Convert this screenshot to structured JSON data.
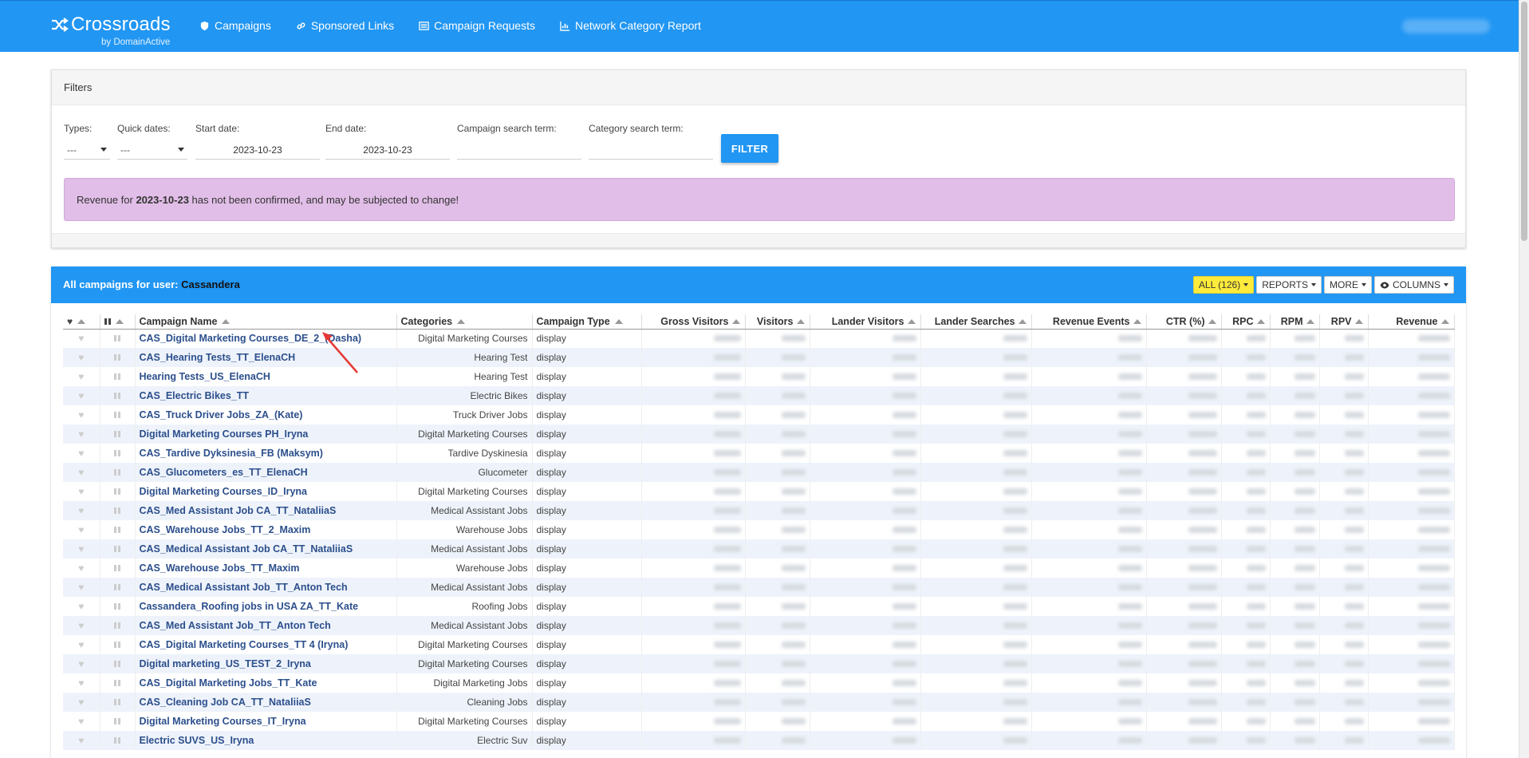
{
  "brand": {
    "name": "Crossroads",
    "sub": "by DomainActive"
  },
  "nav": [
    {
      "label": "Campaigns",
      "icon": "shield-icon"
    },
    {
      "label": "Sponsored Links",
      "icon": "link-icon"
    },
    {
      "label": "Campaign Requests",
      "icon": "list-icon"
    },
    {
      "label": "Network Category Report",
      "icon": "chart-icon"
    }
  ],
  "filters": {
    "title": "Filters",
    "types_label": "Types:",
    "types_value": "---",
    "quick_label": "Quick dates:",
    "quick_value": "---",
    "start_label": "Start date:",
    "start_value": "2023-10-23",
    "end_label": "End date:",
    "end_value": "2023-10-23",
    "campaign_search_label": "Campaign search term:",
    "category_search_label": "Category search term:",
    "filter_button": "FILTER",
    "alert_pre": "Revenue for ",
    "alert_date": "2023-10-23",
    "alert_post": " has not been confirmed, and may be subjected to change!"
  },
  "campaigns": {
    "title_pre": "All campaigns for user: ",
    "user": "Cassandera",
    "buttons": {
      "all": "ALL (126)",
      "reports": "REPORTS",
      "more": "MORE",
      "columns": "COLUMNS"
    },
    "columns": [
      "Campaign Name",
      "Categories",
      "Campaign Type",
      "Gross Visitors",
      "Visitors",
      "Lander Visitors",
      "Lander Searches",
      "Revenue Events",
      "CTR (%)",
      "RPC",
      "RPM",
      "RPV",
      "Revenue"
    ],
    "rows": [
      {
        "name": "CAS_Digital Marketing Courses_DE_2_(Dasha)",
        "category": "Digital Marketing Courses",
        "type": "display"
      },
      {
        "name": "CAS_Hearing Tests_TT_ElenaCH",
        "category": "Hearing Test",
        "type": "display"
      },
      {
        "name": "Hearing Tests_US_ElenaCH",
        "category": "Hearing Test",
        "type": "display"
      },
      {
        "name": "CAS_Electric Bikes_TT",
        "category": "Electric Bikes",
        "type": "display"
      },
      {
        "name": "CAS_Truck Driver Jobs_ZA_(Kate)",
        "category": "Truck Driver Jobs",
        "type": "display"
      },
      {
        "name": "Digital Marketing Courses PH_Iryna",
        "category": "Digital Marketing Courses",
        "type": "display"
      },
      {
        "name": "CAS_Tardive Dyksinesia_FB (Maksym)",
        "category": "Tardive Dyskinesia",
        "type": "display"
      },
      {
        "name": "CAS_Glucometers_es_TT_ElenaCH",
        "category": "Glucometer",
        "type": "display"
      },
      {
        "name": "Digital Marketing Courses_ID_Iryna",
        "category": "Digital Marketing Courses",
        "type": "display"
      },
      {
        "name": "CAS_Med Assistant Job CA_TT_NataliiaS",
        "category": "Medical Assistant Jobs",
        "type": "display"
      },
      {
        "name": "CAS_Warehouse Jobs_TT_2_Maxim",
        "category": "Warehouse Jobs",
        "type": "display"
      },
      {
        "name": "CAS_Medical Assistant Job CA_TT_NataliiaS",
        "category": "Medical Assistant Jobs",
        "type": "display"
      },
      {
        "name": "CAS_Warehouse Jobs_TT_Maxim",
        "category": "Warehouse Jobs",
        "type": "display"
      },
      {
        "name": "CAS_Medical Assistant Job_TT_Anton Tech",
        "category": "Medical Assistant Jobs",
        "type": "display"
      },
      {
        "name": "Cassandera_Roofing jobs in USA ZA_TT_Kate",
        "category": "Roofing Jobs",
        "type": "display"
      },
      {
        "name": "CAS_Med Assistant Job_TT_Anton Tech",
        "category": "Medical Assistant Jobs",
        "type": "display"
      },
      {
        "name": "CAS_Digital Marketing Courses_TT 4 (Iryna)",
        "category": "Digital Marketing Courses",
        "type": "display"
      },
      {
        "name": "Digital marketing_US_TEST_2_Iryna",
        "category": "Digital Marketing Courses",
        "type": "display"
      },
      {
        "name": "CAS_Digital Marketing Jobs_TT_Kate",
        "category": "Digital Marketing Jobs",
        "type": "display"
      },
      {
        "name": "CAS_Cleaning Job CA_TT_NataliiaS",
        "category": "Cleaning Jobs",
        "type": "display"
      },
      {
        "name": "Digital Marketing Courses_IT_Iryna",
        "category": "Digital Marketing Courses",
        "type": "display"
      },
      {
        "name": "Electric SUVS_US_Iryna",
        "category": "Electric Suv",
        "type": "display"
      }
    ]
  }
}
